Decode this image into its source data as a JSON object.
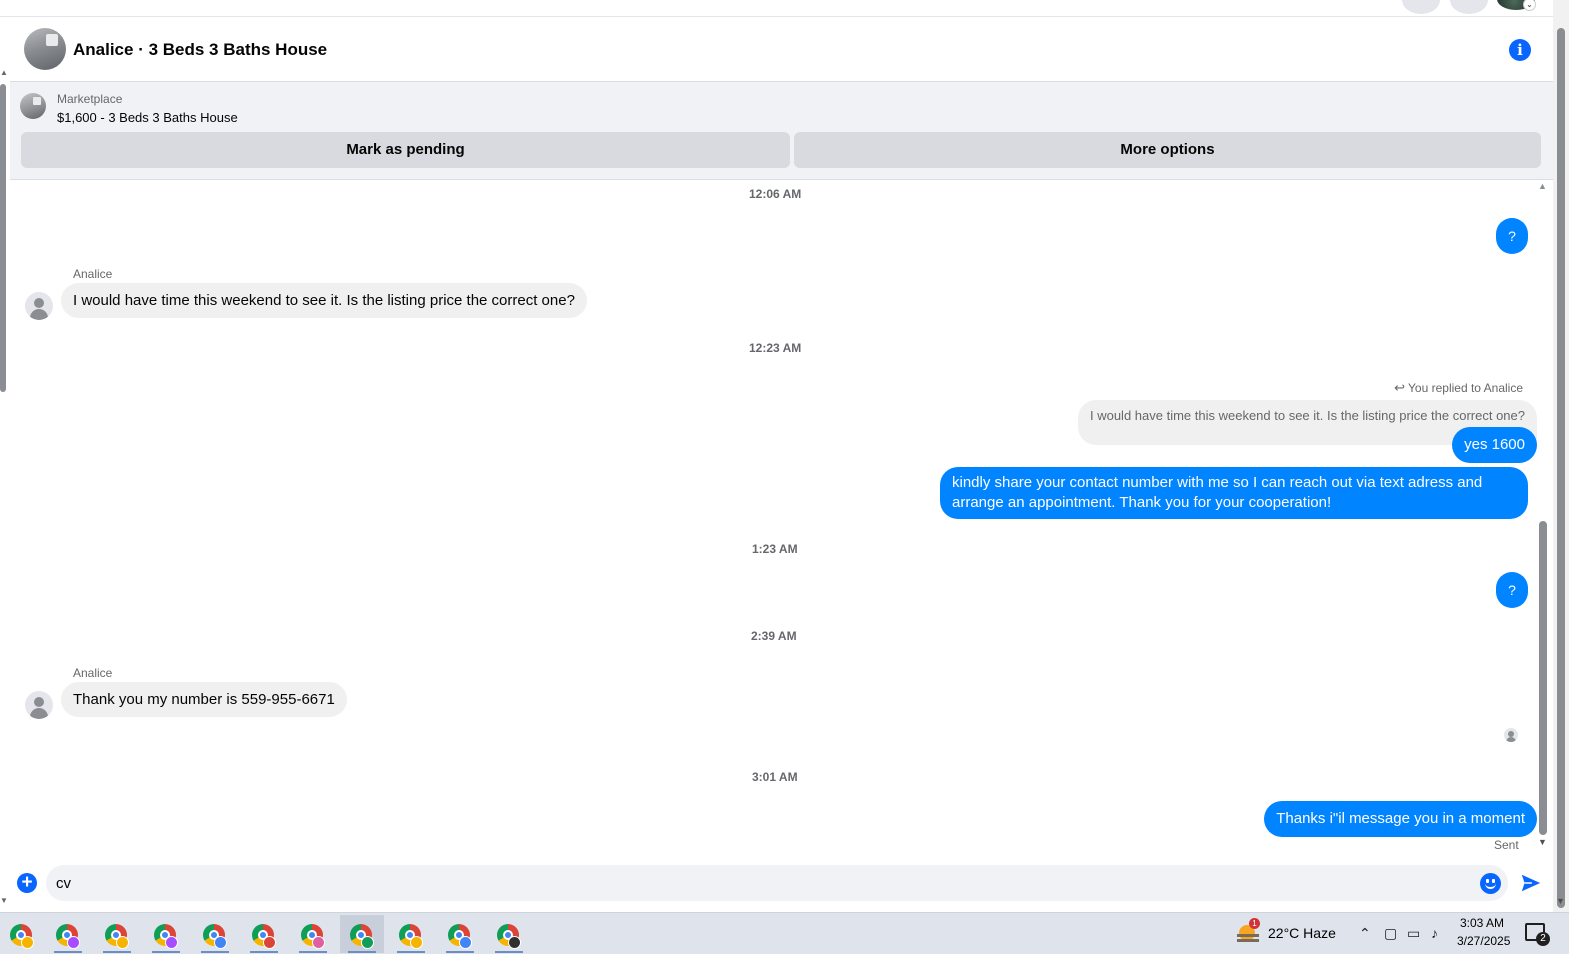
{
  "header": {
    "title": "Analice · 3 Beds 3 Baths House",
    "info_icon": "i"
  },
  "listing": {
    "source_label": "Marketplace",
    "listing_line": "$1,600 - 3 Beds 3 Baths House",
    "mark_pending_label": "Mark as pending",
    "more_options_label": "More options"
  },
  "conversation": {
    "timestamps": [
      "12:06 AM",
      "12:23 AM",
      "1:23 AM",
      "2:39 AM",
      "3:01 AM"
    ],
    "question_mark": "?",
    "sender_name": "Analice",
    "messages": {
      "incoming_1": "I would have time this weekend to see it. Is the listing price the correct one?",
      "reply_note": "You replied to Analice",
      "quoted_text": "I would have time this weekend to see it. Is the listing price the correct one?",
      "outgoing_yes": "yes 1600",
      "outgoing_contact": "kindly share your contact number with me so I can reach out via text adress and arrange an appointment. Thank you for your cooperation!",
      "incoming_2": "Thank you my number is 559-955-6671",
      "outgoing_last": "Thanks i\"il message you in a moment"
    },
    "status_label": "Sent"
  },
  "composer": {
    "input_value": "cv"
  },
  "taskbar": {
    "weather_alert_count": "1",
    "weather_text": "22°C  Haze",
    "clock_time": "3:03 AM",
    "clock_date": "3/27/2025",
    "notification_count": "2",
    "app_badge_colors": [
      "#f4b400",
      "#a64dff",
      "#f4b400",
      "#a64dff",
      "#4285f4",
      "#db4437",
      "#e05fa0",
      "#0f9d58",
      "#f4b400",
      "#4285f4",
      "#303030"
    ]
  },
  "colors": {
    "accent_blue": "#0084ff",
    "info_blue": "#0866ff",
    "incoming_bubble": "#f0f0f0"
  }
}
